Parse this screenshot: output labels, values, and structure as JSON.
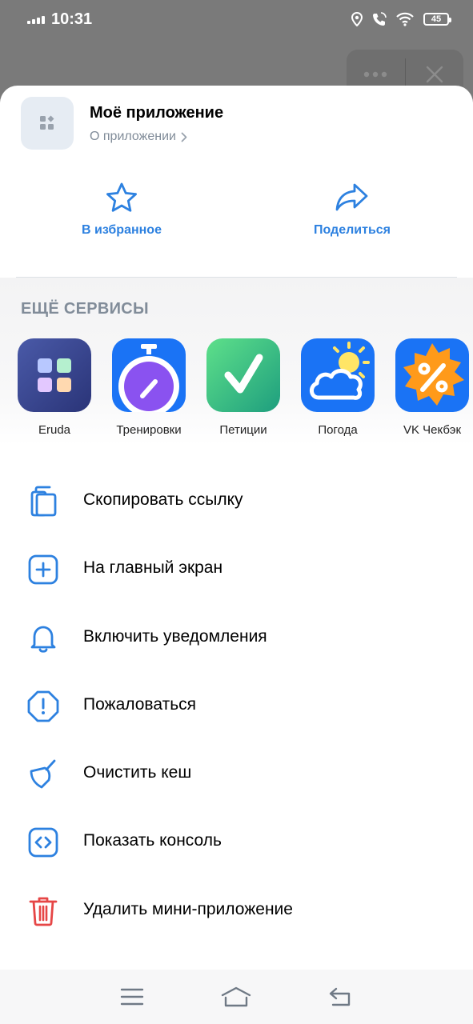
{
  "status_bar": {
    "time": "10:31",
    "battery": "45"
  },
  "app": {
    "name": "Моё приложение",
    "about_link": "О приложении"
  },
  "actions": [
    {
      "label": "В избранное",
      "icon": "star-icon"
    },
    {
      "label": "Поделиться",
      "icon": "share-icon"
    }
  ],
  "services": {
    "title": "ЕЩЁ СЕРВИСЫ",
    "items": [
      {
        "label": "Eruda",
        "icon": "eruda-app-icon"
      },
      {
        "label": "Тренировки",
        "icon": "stopwatch-app-icon"
      },
      {
        "label": "Петиции",
        "icon": "checkmark-app-icon"
      },
      {
        "label": "Погода",
        "icon": "weather-app-icon"
      },
      {
        "label": "VK Чекбэк",
        "icon": "percent-app-icon"
      }
    ]
  },
  "menu": [
    {
      "label": "Скопировать ссылку",
      "icon": "copy-icon"
    },
    {
      "label": "На главный экран",
      "icon": "add-square-icon"
    },
    {
      "label": "Включить уведомления",
      "icon": "bell-icon"
    },
    {
      "label": "Пожаловаться",
      "icon": "report-icon"
    },
    {
      "label": "Очистить кеш",
      "icon": "broom-icon"
    },
    {
      "label": "Показать консоль",
      "icon": "console-icon"
    },
    {
      "label": "Удалить мини-приложение",
      "icon": "trash-icon"
    }
  ],
  "colors": {
    "accent": "#2d81e0",
    "danger": "#e64646",
    "secondary": "#818c99"
  }
}
